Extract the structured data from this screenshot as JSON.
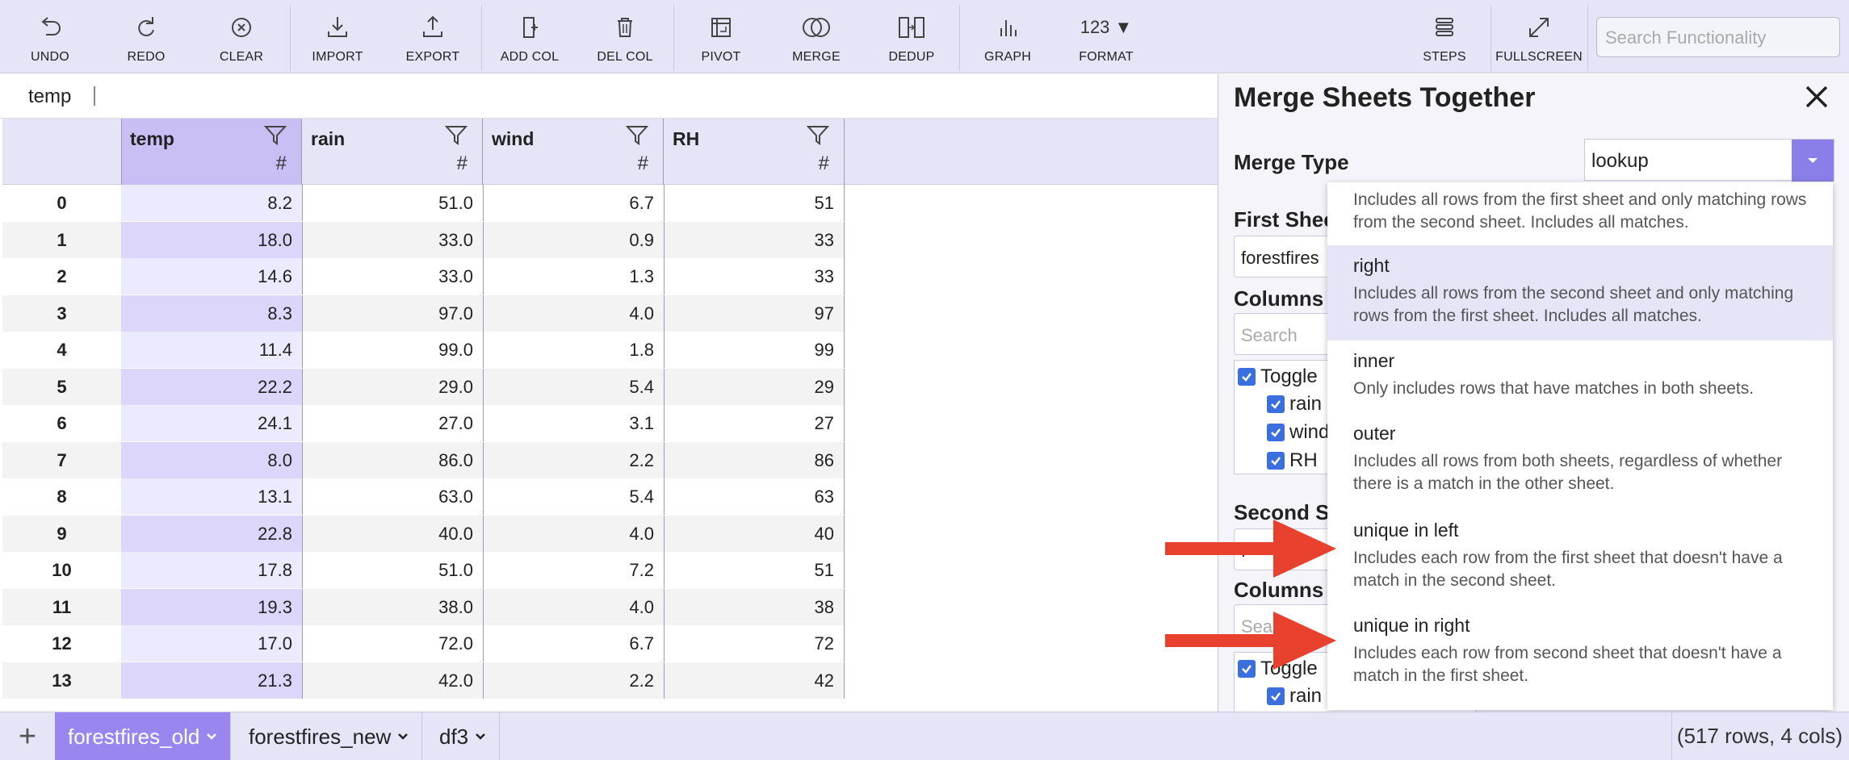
{
  "toolbar": {
    "buttons": [
      {
        "label": "UNDO",
        "icon": "undo-icon"
      },
      {
        "label": "REDO",
        "icon": "redo-icon"
      },
      {
        "label": "CLEAR",
        "icon": "clear-icon"
      },
      {
        "label": "IMPORT",
        "icon": "import-icon"
      },
      {
        "label": "EXPORT",
        "icon": "export-icon"
      },
      {
        "label": "ADD COL",
        "icon": "add-column-icon"
      },
      {
        "label": "DEL COL",
        "icon": "trash-icon"
      },
      {
        "label": "PIVOT",
        "icon": "pivot-icon"
      },
      {
        "label": "MERGE",
        "icon": "merge-icon"
      },
      {
        "label": "DEDUP",
        "icon": "dedup-icon"
      },
      {
        "label": "GRAPH",
        "icon": "graph-icon"
      },
      {
        "label": "FORMAT",
        "icon": "format-icon",
        "icon_text": "123 ▼"
      },
      {
        "label": "STEPS",
        "icon": "steps-icon"
      },
      {
        "label": "FULLSCREEN",
        "icon": "fullscreen-icon"
      }
    ],
    "search_placeholder": "Search Functionality"
  },
  "formula_bar": {
    "cell_name": "temp"
  },
  "grid": {
    "columns": [
      "temp",
      "rain",
      "wind",
      "RH"
    ],
    "type_symbol": "#",
    "rows": [
      {
        "idx": "0",
        "vals": [
          "8.2",
          "51.0",
          "6.7",
          "51"
        ]
      },
      {
        "idx": "1",
        "vals": [
          "18.0",
          "33.0",
          "0.9",
          "33"
        ]
      },
      {
        "idx": "2",
        "vals": [
          "14.6",
          "33.0",
          "1.3",
          "33"
        ]
      },
      {
        "idx": "3",
        "vals": [
          "8.3",
          "97.0",
          "4.0",
          "97"
        ]
      },
      {
        "idx": "4",
        "vals": [
          "11.4",
          "99.0",
          "1.8",
          "99"
        ]
      },
      {
        "idx": "5",
        "vals": [
          "22.2",
          "29.0",
          "5.4",
          "29"
        ]
      },
      {
        "idx": "6",
        "vals": [
          "24.1",
          "27.0",
          "3.1",
          "27"
        ]
      },
      {
        "idx": "7",
        "vals": [
          "8.0",
          "86.0",
          "2.2",
          "86"
        ]
      },
      {
        "idx": "8",
        "vals": [
          "13.1",
          "63.0",
          "5.4",
          "63"
        ]
      },
      {
        "idx": "9",
        "vals": [
          "22.8",
          "40.0",
          "4.0",
          "40"
        ]
      },
      {
        "idx": "10",
        "vals": [
          "17.8",
          "51.0",
          "7.2",
          "51"
        ]
      },
      {
        "idx": "11",
        "vals": [
          "19.3",
          "38.0",
          "4.0",
          "38"
        ]
      },
      {
        "idx": "12",
        "vals": [
          "17.0",
          "72.0",
          "6.7",
          "72"
        ]
      },
      {
        "idx": "13",
        "vals": [
          "21.3",
          "42.0",
          "2.2",
          "42"
        ]
      }
    ]
  },
  "panel": {
    "title": "Merge Sheets Together",
    "merge_type_label": "Merge Type",
    "merge_type_value": "lookup",
    "first_sheet_label": "First Shee",
    "first_sheet_value": "forestfires",
    "columns_label_1": "Columns",
    "search_placeholder_1": "Search",
    "toggle_label_1": "Toggle",
    "col_items_1": [
      "rain",
      "wind",
      "RH"
    ],
    "second_sheet_label": "Second Sh",
    "second_sheet_value": "f",
    "columns_label_2": "Columns",
    "search_placeholder_2": "Sea",
    "toggle_label_2": "Toggle",
    "col_items_2": [
      "rain"
    ]
  },
  "dropdown": {
    "options": [
      {
        "title": "",
        "desc": "Includes all rows from the first sheet and only matching rows from the second sheet. Includes all matches."
      },
      {
        "title": "right",
        "desc": "Includes all rows from the second sheet and only matching rows from the first sheet. Includes all matches.",
        "highlighted": true
      },
      {
        "title": "inner",
        "desc": "Only includes rows that have matches in both sheets."
      },
      {
        "title": "outer",
        "desc": "Includes all rows from both sheets, regardless of whether there is a match in the other sheet."
      },
      {
        "title": "unique in left",
        "desc": "Includes each row from the first sheet that doesn't have a match in the second sheet."
      },
      {
        "title": "unique in right",
        "desc": "Includes each row from second sheet that doesn't have a match in the first sheet."
      }
    ]
  },
  "sheets": {
    "add_label": "+",
    "tabs": [
      {
        "label": "forestfires_old",
        "active": true
      },
      {
        "label": "forestfires_new",
        "active": false
      },
      {
        "label": "df3",
        "active": false
      }
    ],
    "rows_info": "(517 rows, 4 cols)"
  },
  "colors": {
    "accent": "#9a86ef",
    "selected_col": "#c9bff5",
    "arrow": "#e8412e",
    "checkbox": "#3b6fe0"
  }
}
